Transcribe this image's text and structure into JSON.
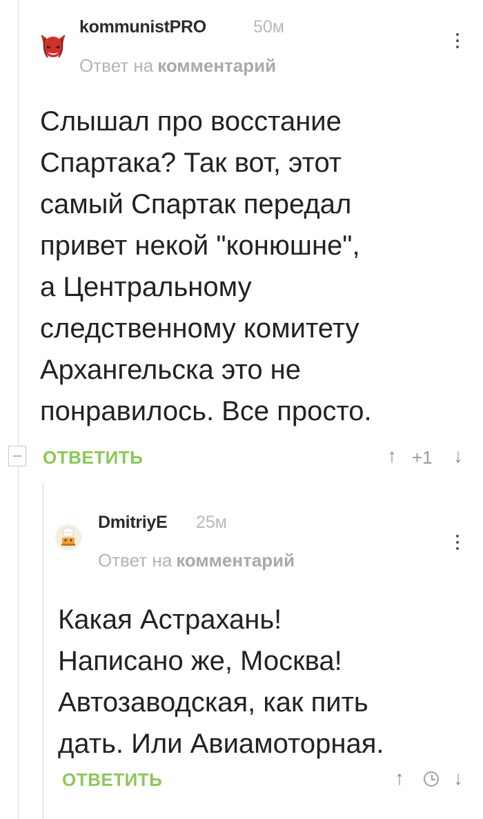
{
  "comments": [
    {
      "username": "kommunistPRO",
      "time": "50м",
      "reply_prefix": "Ответ на",
      "reply_link": "комментарий",
      "body_lines": [
        "Слышал про восстание",
        "Спартака? Так вот, этот",
        "самый Спартак передал",
        "привет некой \"конюшне\",",
        "а Центральному",
        "следственному комитету",
        "Архангельска это не",
        "понравилось. Все просто."
      ],
      "reply_button": "ОТВЕТИТЬ",
      "rating": "+1",
      "up_arrow": "↑",
      "down_arrow": "↓",
      "avatar_icon": "devil-avatar-icon"
    },
    {
      "username": "DmitriyE",
      "time": "25м",
      "reply_prefix": "Ответ на",
      "reply_link": "комментарий",
      "body_lines": [
        "Какая Астрахань!",
        "Написано же, Москва!",
        "Автозаводская, как пить",
        "дать. Или Авиамоторная."
      ],
      "reply_button": "ОТВЕТИТЬ",
      "up_arrow": "↑",
      "down_arrow": "↓",
      "avatar_icon": "chef-avatar-icon",
      "rating_hidden_icon": "clock-icon"
    }
  ],
  "colors": {
    "accent_green": "#8ac858",
    "muted_gray": "#b3b3b3",
    "text": "#222222"
  }
}
